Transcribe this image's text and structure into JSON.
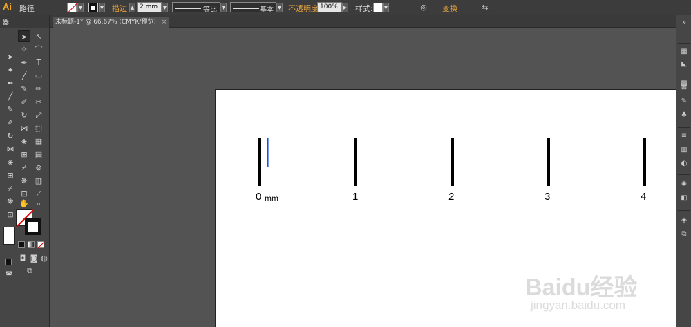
{
  "control_bar": {
    "logo": "Ai",
    "selection_label": "路径",
    "stroke_link": "描边",
    "stroke_weight_value": "2 mm",
    "profile_label": "等比",
    "brush_label": "基本",
    "opacity_link": "不透明度",
    "opacity_value": "100%",
    "style_label": "样式:",
    "transform_link": "变换"
  },
  "document": {
    "tab_title": "未标题-1* @ 66.67% (CMYK/预览)",
    "tab_close": "×"
  },
  "tools_panel": {
    "header": "器"
  },
  "artboard": {
    "labels": [
      "0",
      "1",
      "2",
      "3",
      "4"
    ],
    "unit": "mm"
  },
  "watermark": {
    "main": "Baidu经验",
    "sub": "jingyan.baidu.com"
  },
  "colors": {
    "ui_background": "#535353",
    "panel": "#464646",
    "accent_link": "#e9a23b",
    "selection_blue": "#2a4dd6"
  }
}
